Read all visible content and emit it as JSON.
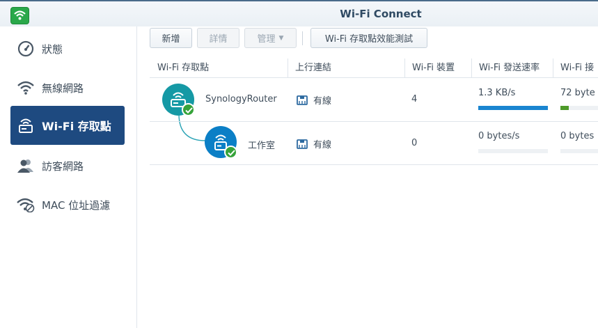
{
  "app": {
    "title": "Wi-Fi Connect"
  },
  "sidebar": {
    "items": [
      {
        "label": "狀態",
        "icon": "gauge-icon"
      },
      {
        "label": "無線網路",
        "icon": "wifi-icon"
      },
      {
        "label": "Wi-Fi 存取點",
        "icon": "router-icon",
        "active": true
      },
      {
        "label": "訪客網路",
        "icon": "guest-users-icon"
      },
      {
        "label": "MAC 位址過濾",
        "icon": "wifi-filter-icon"
      }
    ]
  },
  "toolbar": {
    "add_label": "新增",
    "details_label": "詳情",
    "manage_label": "管理",
    "speedtest_label": "Wi-Fi 存取點效能測試"
  },
  "grid": {
    "columns": [
      "Wi-Fi 存取點",
      "上行連結",
      "Wi-Fi 裝置",
      "Wi-Fi 發送速率",
      "Wi-Fi 接"
    ],
    "rows": [
      {
        "name": "SynologyRouter",
        "uplink": "有線",
        "devices": "4",
        "tx_rate": "1.3 KB/s",
        "tx_level": 1.0,
        "rx_rate": "72 byte",
        "rx_level": 0.2
      },
      {
        "name": "工作室",
        "uplink": "有線",
        "devices": "0",
        "tx_rate": "0 bytes/s",
        "tx_level": 0,
        "rx_rate": "0 bytes",
        "rx_level": 0
      }
    ]
  },
  "colors": {
    "accent": "#1e4a80",
    "router_primary": "#1599a5",
    "router_satellite": "#0b7fc6",
    "status_ok": "#36a33a",
    "tx_bar": "#1a85d0",
    "rx_bar": "#4e9a2a"
  }
}
